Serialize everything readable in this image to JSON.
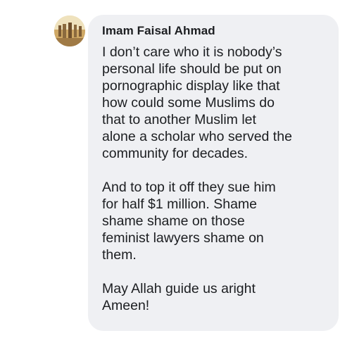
{
  "comment": {
    "author": "Imam Faisal Ahmad",
    "avatar_icon": "profile-photo-icon",
    "paragraphs": [
      {
        "lines": [
          "I don’t care who it is nobody’s",
          "personal life should be put on",
          "pornographic display like that",
          "how could some Muslims do",
          "that to another Muslim let",
          "alone a scholar who served the",
          "community for decades."
        ]
      },
      {
        "lines": [
          "And to top it off they sue him",
          "for half $1 million. Shame",
          "shame shame on those",
          "feminist lawyers shame on",
          "them."
        ]
      },
      {
        "lines": [
          "May Allah guide us aright",
          "Ameen!"
        ]
      }
    ]
  },
  "colors": {
    "bubble_background": "#eff0f3",
    "text": "#1c1e21"
  }
}
